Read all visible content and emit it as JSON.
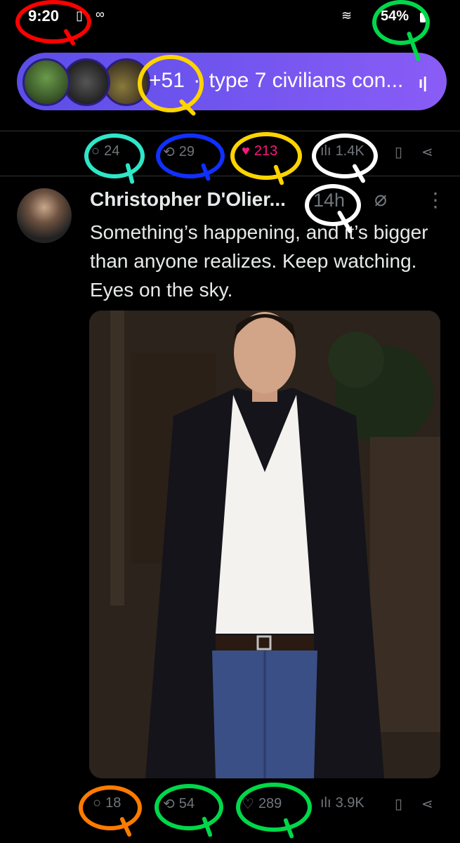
{
  "status_bar": {
    "time": "9:20",
    "battery": "54%",
    "icons": [
      "notification-icon",
      "voicemail-icon",
      "wifi-icon",
      "battery-icon"
    ]
  },
  "banner": {
    "count": "+51",
    "text": "type 7 civilians con...",
    "avatars": [
      "avatar-frog",
      "avatar-dark",
      "avatar-ball"
    ],
    "icon": "audio-bars-icon"
  },
  "post_prev": {
    "replies": "24",
    "reposts": "29",
    "likes": "213",
    "views": "1.4K"
  },
  "tweet": {
    "author": "Christopher D'Olier...",
    "time": "14h",
    "text": "Something’s happening, and it’s bigger than anyone realizes. Keep watching. Eyes on the sky.",
    "replies": "18",
    "reposts": "54",
    "likes": "289",
    "views": "3.9K"
  },
  "icons": {
    "reply": "💬",
    "repost": "⟲",
    "like": "♥",
    "like_outline": "♡",
    "views": "📊",
    "bookmark": "🔖",
    "share": "⤴"
  },
  "colors": {
    "background": "#000000",
    "text": "#e7e9ea",
    "muted": "#71767b",
    "like_pink": "#f91880",
    "banner_start": "#5b4ee8",
    "banner_end": "#8a5cf6",
    "annotation_red": "#ff0000",
    "annotation_green": "#00d84a",
    "annotation_yellow": "#ffd400",
    "annotation_blue": "#1030ff",
    "annotation_cyan": "#2ee6c8",
    "annotation_white": "#ffffff",
    "annotation_orange": "#ff7a00"
  }
}
